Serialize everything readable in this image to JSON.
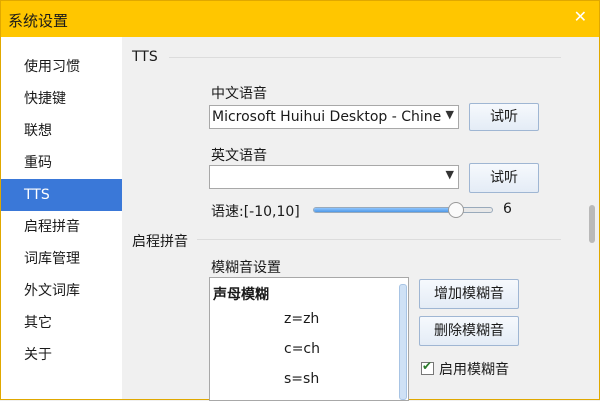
{
  "window": {
    "title": "系统设置",
    "close_glyph": "✕"
  },
  "sidebar": {
    "items": [
      {
        "label": "使用习惯"
      },
      {
        "label": "快捷键"
      },
      {
        "label": "联想"
      },
      {
        "label": "重码"
      },
      {
        "label": "TTS",
        "selected": true
      },
      {
        "label": "启程拼音"
      },
      {
        "label": "词库管理"
      },
      {
        "label": "外文词库"
      },
      {
        "label": "其它"
      },
      {
        "label": "关于"
      }
    ]
  },
  "tts": {
    "section_title": "TTS",
    "chinese_voice_label": "中文语音",
    "chinese_voice_value": "Microsoft Huihui Desktop - Chinese",
    "chinese_test_button": "试听",
    "english_voice_label": "英文语音",
    "english_voice_value": "",
    "english_test_button": "试听",
    "speed_label": "语速:[-10,10]",
    "speed_value": "6"
  },
  "pinyin": {
    "section_title": "启程拼音",
    "fuzzy_label": "模糊音设置",
    "list_heading": "声母模糊",
    "list_items": [
      "z=zh",
      "c=ch",
      "s=sh"
    ],
    "add_button": "增加模糊音",
    "remove_button": "删除模糊音",
    "enable_label": "启用模糊音",
    "enable_checked": true
  },
  "icons": {
    "dropdown": "chevron-down-icon",
    "close": "close-icon",
    "check": "check-icon"
  },
  "colors": {
    "titlebar": "#ffc600",
    "selected": "#3a78d8"
  }
}
